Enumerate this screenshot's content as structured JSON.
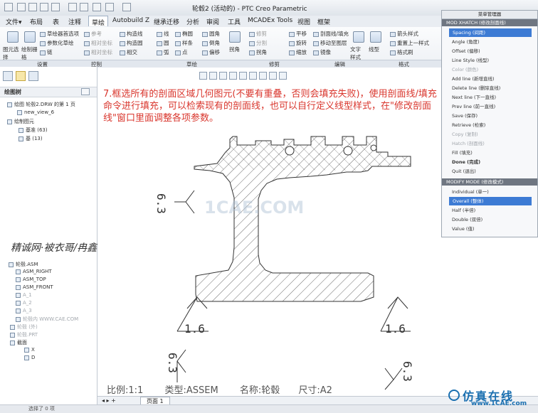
{
  "app": {
    "title": "轮毂2 (活动的) - PTC Creo Parametric"
  },
  "tabs": [
    "文件▾",
    "布局",
    "表",
    "注释",
    "草绘",
    "Autobuild Z",
    "继承迁移",
    "分析",
    "审阅",
    "工具",
    "MCADEx Tools",
    "视图",
    "框架"
  ],
  "active_tab": "草绘",
  "ribbon": {
    "col1": [
      "草绘器首选项",
      "参数化草绘",
      "链"
    ],
    "col2": [
      "参考",
      "相对坐标",
      "相对坐标"
    ],
    "col3": [
      "构造线",
      "构造圆",
      "相交",
      "线",
      "圆",
      "弧"
    ],
    "col4": [
      "椭圆",
      "样条",
      "点"
    ],
    "col5": [
      "圆角",
      "倒角",
      "偏移"
    ],
    "col6": [
      "修剪",
      "分割",
      "拐角"
    ],
    "col7": [
      "平移",
      "旋转",
      "缩放"
    ],
    "col8": [
      "剖面线/填充",
      "移动至图层",
      "镜像"
    ],
    "col9": [
      "箭头样式",
      "重置上一样式",
      "格式刷"
    ],
    "big1": "图元选择",
    "big2": "绘制栅格",
    "big3": "拐角",
    "big4": "文字样式",
    "big5": "线型"
  },
  "groups": [
    "设置",
    "控制",
    "草绘",
    "修剪",
    "编辑",
    "格式"
  ],
  "left_panel": {
    "header": "绘图树",
    "items": [
      "绘图 轮毂2.DRW 的第 1 页",
      "new_view_6",
      "绘制图元",
      "基准 (63)",
      "基 (13)"
    ],
    "model_items": [
      "轮毂.ASM",
      "ASM_RIGHT",
      "ASM_TOP",
      "ASM_FRONT",
      "A_1",
      "A_2",
      "A_3",
      "轮毂内 WWW.CAE.COM",
      "轮毂 (外)",
      "轮毂.PRT",
      "截面",
      "X",
      "D"
    ]
  },
  "annotation": "7.框选所有的剖面区域几何图元(不要有重叠，否则会填充失败)，使用剖面线/填充命令进行填充，可以检索现有的剖面线，也可以自行定义线型样式，在\"修改剖面线\"窗口里面调整各项参数。",
  "signature": "精诚网·被衣哥/冉鑫",
  "drawing": {
    "roughness_left": "6.3",
    "roughness_bl": "1.6",
    "roughness_br": "1.6",
    "roughness_bottom": "6.3",
    "roughness_corner": "6.3",
    "watermark": "1CAE.COM"
  },
  "footer": {
    "scale": "比例:1:1",
    "type": "类型:ASSEM",
    "name": "名称:轮毂",
    "size": "尺寸:A2"
  },
  "statusbar": {
    "page": "页面 1",
    "bottom_text": "选择了 0 项"
  },
  "brand": {
    "name": "仿真在线",
    "url": "www.1CAE.com"
  },
  "menu_manager": {
    "title": "菜单管理器",
    "section1": "MOD XHATCH (修改剖面线)",
    "items1": [
      {
        "label": "Spacing (间距)",
        "state": "selected"
      },
      {
        "label": "Angle (角度)",
        "state": "normal"
      },
      {
        "label": "Offset (偏移)",
        "state": "normal"
      },
      {
        "label": "Line Style (线型)",
        "state": "normal"
      },
      {
        "label": "Color (颜色)",
        "state": "dim"
      },
      {
        "label": "Add line (新增直线)",
        "state": "normal"
      },
      {
        "label": "Delete line (删除直线)",
        "state": "normal"
      },
      {
        "label": "Next line (下一直线)",
        "state": "normal"
      },
      {
        "label": "Prev line (前一直线)",
        "state": "normal"
      },
      {
        "label": "Save (保存)",
        "state": "normal"
      },
      {
        "label": "Retrieve (检索)",
        "state": "normal"
      },
      {
        "label": "Copy (复制)",
        "state": "dim"
      },
      {
        "label": "Hatch (剖面线)",
        "state": "dim"
      },
      {
        "label": "Fill (填充)",
        "state": "normal"
      },
      {
        "label": "Done (完成)",
        "state": "bold"
      },
      {
        "label": "Quit (退出)",
        "state": "normal"
      }
    ],
    "section2": "MODIFY MODE (修改模式)",
    "items2": [
      {
        "label": "Individual (单一)",
        "state": "normal"
      },
      {
        "label": "Overall (整体)",
        "state": "selected"
      },
      {
        "label": "Half (半倍)",
        "state": "normal"
      },
      {
        "label": "Double (双倍)",
        "state": "normal"
      },
      {
        "label": "Value (值)",
        "state": "normal"
      }
    ]
  }
}
